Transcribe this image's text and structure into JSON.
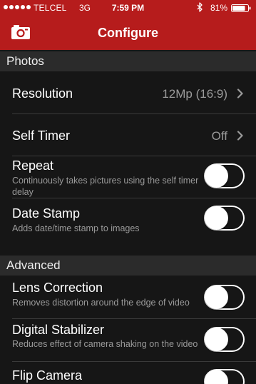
{
  "status_bar": {
    "carrier": "TELCEL",
    "network": "3G",
    "time": "7:59 PM",
    "battery_percent": "81%",
    "icons": [
      "signal-dots-icon",
      "bluetooth-icon",
      "battery-icon"
    ]
  },
  "nav": {
    "title": "Configure",
    "left_icon": "camera-icon"
  },
  "colors": {
    "header_bg": "#b61c1c",
    "page_bg": "#161616",
    "section_bg": "#2b2b2b",
    "secondary_text": "#9a9a9a"
  },
  "sections": {
    "photos": {
      "title": "Photos",
      "resolution": {
        "title": "Resolution",
        "value": "12Mp (16:9)"
      },
      "self_timer": {
        "title": "Self Timer",
        "value": "Off"
      },
      "repeat": {
        "title": "Repeat",
        "subtitle": "Continuously takes pictures using the self timer delay",
        "enabled": false
      },
      "date_stamp": {
        "title": "Date Stamp",
        "subtitle": "Adds date/time stamp to images",
        "enabled": false
      }
    },
    "advanced": {
      "title": "Advanced",
      "lens_correction": {
        "title": "Lens Correction",
        "subtitle": "Removes distortion around the edge of video",
        "enabled": false
      },
      "digital_stabilizer": {
        "title": "Digital Stabilizer",
        "subtitle": "Reduces effect of camera shaking on the video",
        "enabled": false
      },
      "flip_camera": {
        "title": "Flip Camera",
        "enabled": false
      }
    }
  }
}
